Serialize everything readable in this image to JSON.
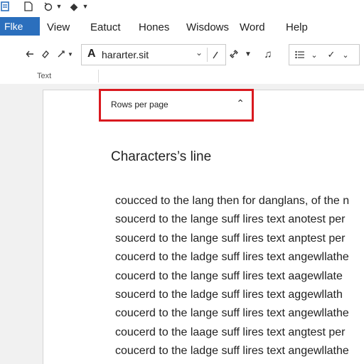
{
  "menubar": {
    "file": "Flke",
    "items": [
      "View",
      "Eatuct",
      "Hones",
      "Wisdows",
      "Word",
      "Help"
    ]
  },
  "toolbar": {
    "font_name": "hararter.sit",
    "group_label": "Text"
  },
  "dropdown": {
    "label": "Rows per page"
  },
  "document": {
    "heading": "Characters’s line",
    "lines": [
      "coucced to the lang then for danglans, of the n",
      "soucerd to the lange suff lires text anotest per",
      "soucerd to the lange suff lires text anptest per",
      "coucerd to the ladge suff lires text angewllathe",
      "coucerd to the lange suff lires text aagewllate",
      "soucerd to the ladge suff lires text aggewllath",
      "coucerd to the lange suff lires text angewllathe",
      "coucerd to the laage suff lires text angtest per",
      "coucerd to the ladge suff lires text angewllathe"
    ]
  },
  "colors": {
    "accent": "#2b6fbd",
    "highlight_border": "#d9191f"
  }
}
